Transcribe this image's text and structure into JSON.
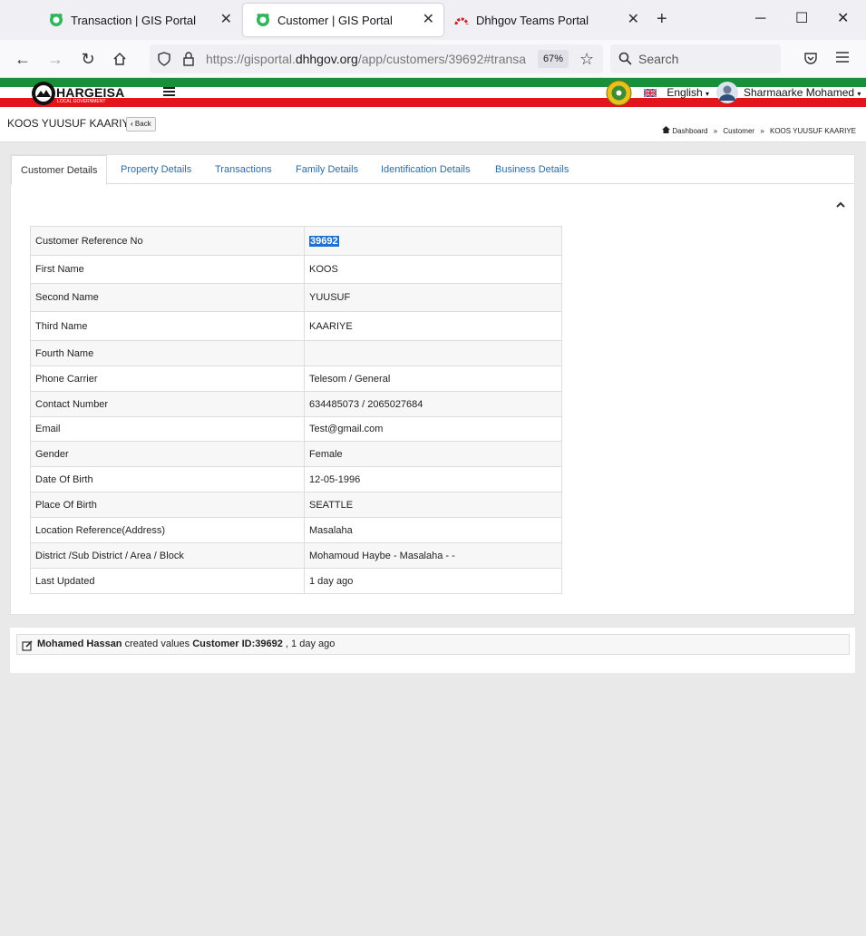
{
  "browser": {
    "tabs": [
      {
        "title": "Transaction | GIS Portal",
        "active": false
      },
      {
        "title": "Customer | GIS Portal",
        "active": true
      },
      {
        "title": "Dhhgov Teams Portal",
        "active": false
      }
    ],
    "url_prefix": "https://gisportal.",
    "url_domain": "dhhgov.org",
    "url_path": "/app/customers/39692#transa",
    "zoom": "67%",
    "search_placeholder": "Search"
  },
  "header": {
    "logo_text": "HARGEISA",
    "logo_sub": "LOCAL GOVERNMENT",
    "language": "English",
    "user_name": "Sharmaarke Mohamed",
    "stripe_green": "#1a8f3a",
    "stripe_red": "#e2141c"
  },
  "page": {
    "title": "KOOS YUUSUF KAARIYE",
    "back_label": "Back",
    "breadcrumb": [
      "Dashboard",
      "Customer",
      "KOOS YUUSUF KAARIYE"
    ],
    "breadcrumb_sep": "»"
  },
  "tabs": [
    "Customer Details",
    "Property Details",
    "Transactions",
    "Family Details",
    "Identification Details",
    "Business Details"
  ],
  "details": [
    {
      "label": "Customer Reference No",
      "value": "39692"
    },
    {
      "label": "First Name",
      "value": "KOOS"
    },
    {
      "label": "Second Name",
      "value": "YUUSUF"
    },
    {
      "label": "Third Name",
      "value": "KAARIYE"
    },
    {
      "label": "Fourth Name",
      "value": ""
    },
    {
      "label": "Phone Carrier",
      "value": "Telesom / General"
    },
    {
      "label": "Contact Number",
      "value": "634485073 / 2065027684"
    },
    {
      "label": "Email",
      "value": "Test@gmail.com"
    },
    {
      "label": "Gender",
      "value": "Female"
    },
    {
      "label": "Date Of Birth",
      "value": "12-05-1996"
    },
    {
      "label": "Place Of Birth",
      "value": "SEATTLE"
    },
    {
      "label": "Location Reference(Address)",
      "value": "Masalaha"
    },
    {
      "label": "District /Sub District / Area / Block",
      "value": "Mohamoud Haybe - Masalaha - -"
    },
    {
      "label": "Last Updated",
      "value": "1 day ago"
    }
  ],
  "activity": {
    "user": "Mohamed Hassan",
    "action": "created values",
    "target": "Customer ID:39692",
    "time": ", 1 day ago"
  }
}
